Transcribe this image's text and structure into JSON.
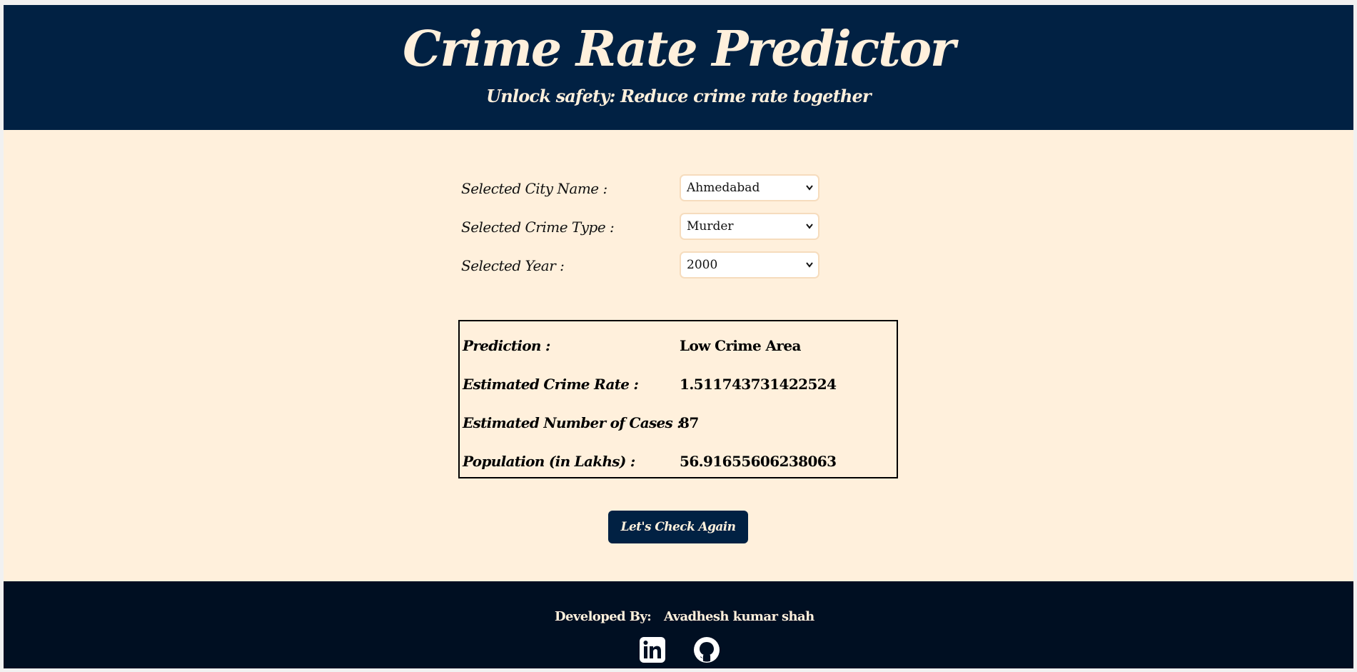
{
  "header": {
    "title": "Crime Rate Predictor",
    "subtitle": "Unlock safety: Reduce crime rate together"
  },
  "form": {
    "city_label": "Selected City Name :",
    "city_value": "Ahmedabad",
    "crime_label": "Selected Crime Type :",
    "crime_value": "Murder",
    "year_label": "Selected Year :",
    "year_value": "2000"
  },
  "results": {
    "prediction_label": "Prediction :",
    "prediction_value": "Low Crime Area",
    "rate_label": "Estimated Crime Rate :",
    "rate_value": "1.511743731422524",
    "cases_label": "Estimated Number of Cases :",
    "cases_value": "87",
    "population_label": "Population (in Lakhs) :",
    "population_value": "56.91655606238063"
  },
  "actions": {
    "check_again_label": "Let's Check Again"
  },
  "footer": {
    "developed_by_label": "Developed By:",
    "developer_name": "Avadhesh kumar shah",
    "icons": [
      "linkedin-icon",
      "github-icon"
    ]
  },
  "colors": {
    "navy": "#012143",
    "cream": "#fff0dc",
    "footer_bg": "#000f22"
  }
}
